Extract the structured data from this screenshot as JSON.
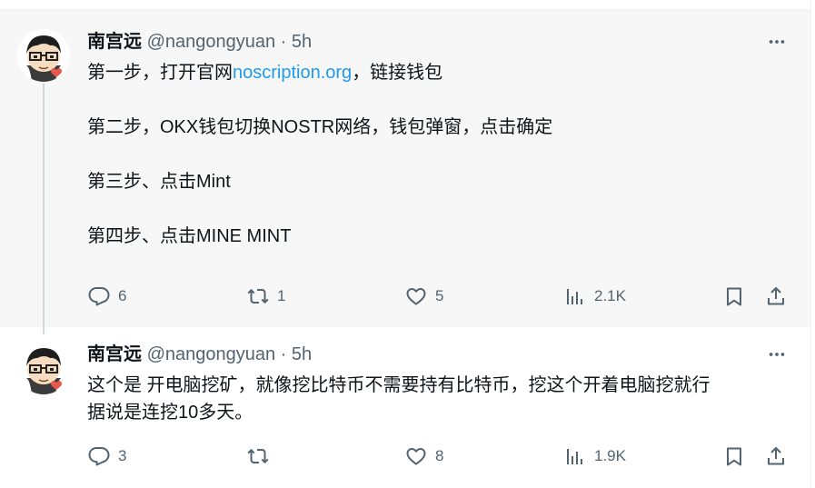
{
  "tweets": [
    {
      "author": {
        "name": "南宫远",
        "handle": "@nangongyuan",
        "separator": "·",
        "time": "5h"
      },
      "lines": [
        {
          "before": "第一步，打开官网",
          "link": "noscription.org",
          "after": "，链接钱包"
        },
        {
          "text": "第二步，OKX钱包切换NOSTR网络，钱包弹窗，点击确定"
        },
        {
          "text": "第三步、点击Mint"
        },
        {
          "text": "第四步、点击MINE MINT"
        }
      ],
      "actions": {
        "replies": "6",
        "reposts": "1",
        "likes": "5",
        "views": "2.1K"
      }
    },
    {
      "author": {
        "name": "南宫远",
        "handle": "@nangongyuan",
        "separator": "·",
        "time": "5h"
      },
      "lines": [
        {
          "text": "这个是 开电脑挖矿，就像挖比特币不需要持有比特币，挖这个开着电脑挖就行"
        },
        {
          "text": "据说是连挖10多天。"
        }
      ],
      "actions": {
        "replies": "3",
        "reposts": "",
        "likes": "8",
        "views": "1.9K"
      }
    }
  ],
  "icons": {
    "reply": "reply-icon",
    "repost": "repost-icon",
    "like": "heart-icon",
    "views": "views-icon",
    "bookmark": "bookmark-icon",
    "share": "share-icon",
    "more": "more-icon"
  },
  "colors": {
    "text": "#0f1419",
    "secondary": "#536471",
    "link": "#1d9bf0",
    "thread_line": "#cfd9de",
    "avatar_heart": "#e8574c"
  }
}
